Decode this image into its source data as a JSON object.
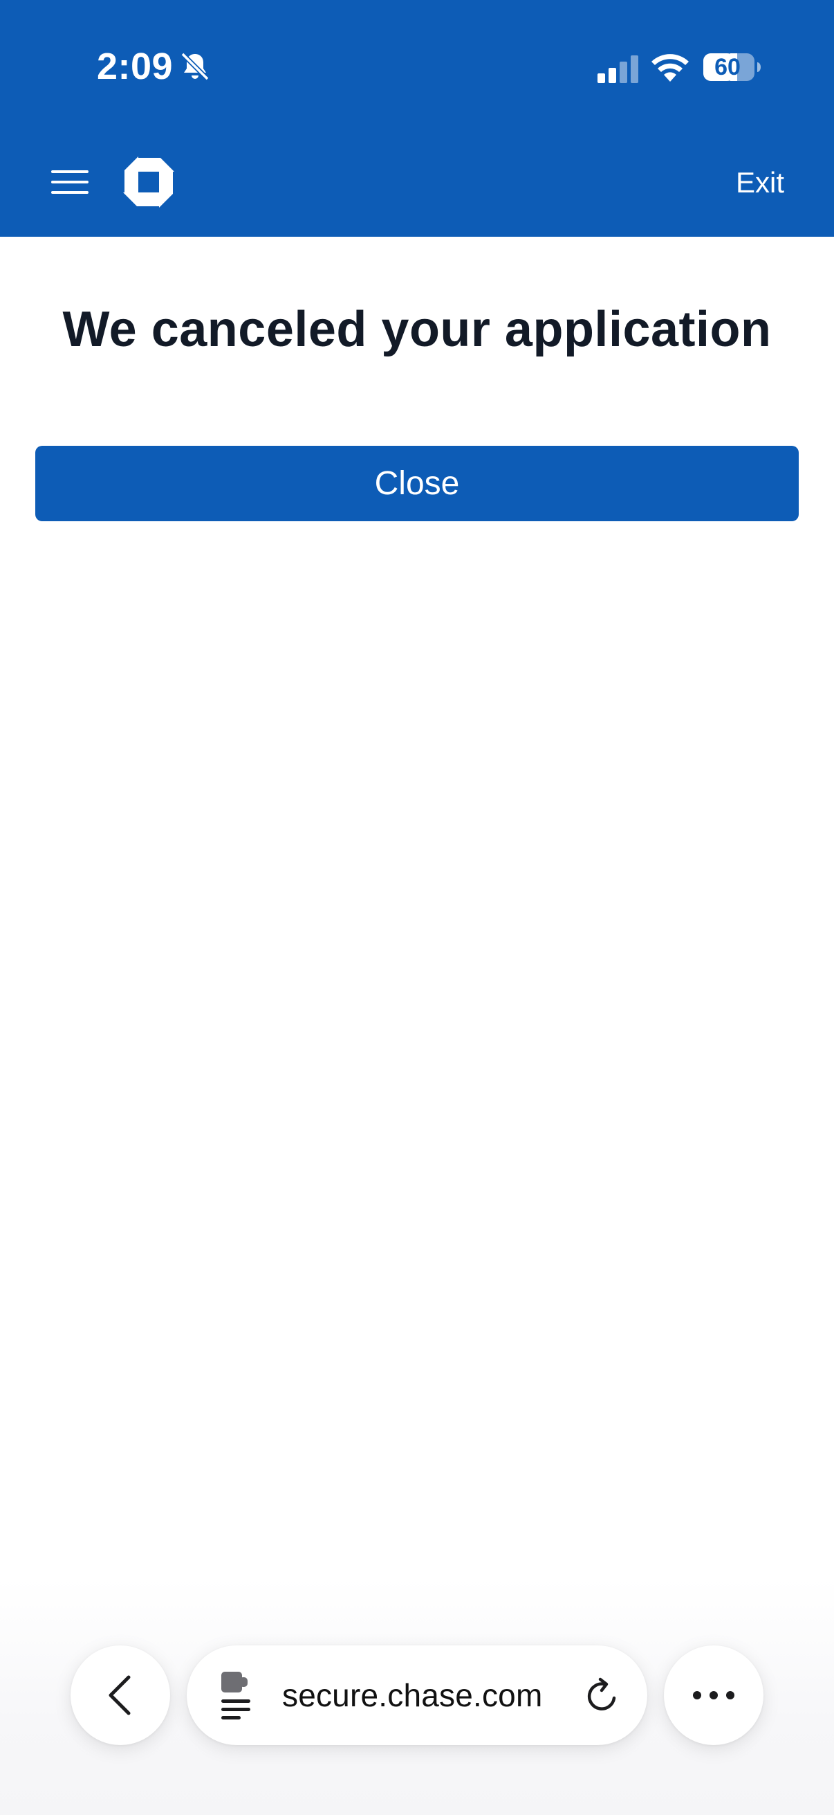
{
  "status_bar": {
    "time": "2:09",
    "battery_percent": "60",
    "silent_mode": "bell-off-icon",
    "signal_bars_active": 2,
    "signal_bars_total": 4
  },
  "header": {
    "exit_label": "Exit",
    "menu_icon": "hamburger-menu-icon",
    "logo_icon": "chase-logo-icon"
  },
  "main": {
    "title": "We canceled your application",
    "close_label": "Close"
  },
  "browser_toolbar": {
    "url": "secure.chase.com",
    "back_icon": "chevron-left-icon",
    "reader_icon": "page-extension-icon",
    "reload_icon": "reload-icon",
    "more_icon": "more-dots-icon"
  },
  "colors": {
    "brand_blue": "#0d5cb6",
    "title_text": "#121a27",
    "background": "#ffffff"
  }
}
